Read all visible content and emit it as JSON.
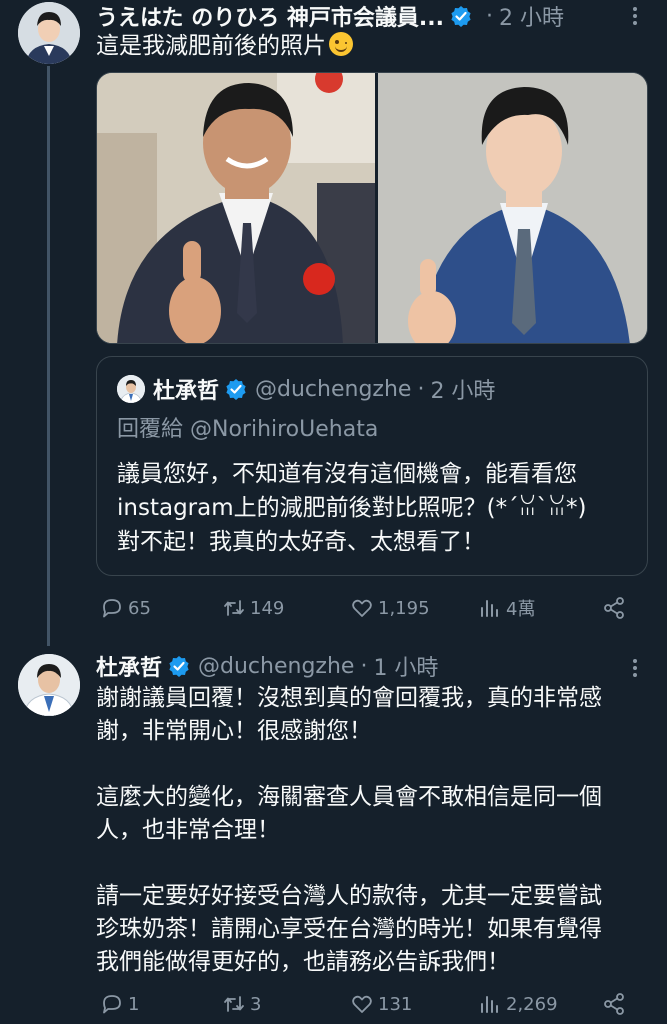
{
  "tweet1": {
    "display_name": "うえはた のりひろ 神戸市会議員...",
    "dot": "·",
    "time": "2 小時",
    "text": "這是我減肥前後的照片",
    "quote": {
      "display_name": "杜承哲",
      "handle": "@duchengzhe",
      "dot": "·",
      "time": "2 小時",
      "reply_to": "回覆給 @NorihiroUehata",
      "text_line1": "議員您好，不知道有沒有這個機會，能看看您",
      "text_line2": "instagram上的減肥前後對比照呢？(*´ꈍ`ꈍ*)",
      "text_line3": "對不起！我真的太好奇、太想看了！"
    },
    "actions": {
      "replies": "65",
      "retweets": "149",
      "likes": "1,195",
      "views": "4萬"
    }
  },
  "tweet2": {
    "display_name": "杜承哲",
    "handle": "@duchengzhe",
    "dot": "·",
    "time": "1 小時",
    "para1_line1": "謝謝議員回覆！沒想到真的會回覆我，真的非常感",
    "para1_line2": "謝，非常開心！很感謝您！",
    "para2_line1": "這麼大的變化，海關審查人員會不敢相信是同一個",
    "para2_line2": "人，也非常合理！",
    "para3_line1": "請一定要好好接受台灣人的款待，尤其一定要嘗試",
    "para3_line2": "珍珠奶茶！請開心享受在台灣的時光！如果有覺得",
    "para3_line3": "我們能做得更好的，也請務必告訴我們！",
    "actions": {
      "replies": "1",
      "retweets": "3",
      "likes": "131",
      "views": "2,269"
    }
  },
  "colors": {
    "background": "#15202b",
    "text": "#f7f9f9",
    "muted": "#8b98a5",
    "verified": "#1d9bf0",
    "border": "#38444d"
  },
  "icons": [
    "verified-badge-icon",
    "more-icon",
    "reply-icon",
    "retweet-icon",
    "like-icon",
    "views-icon",
    "share-icon",
    "smiling-emoji-icon"
  ]
}
